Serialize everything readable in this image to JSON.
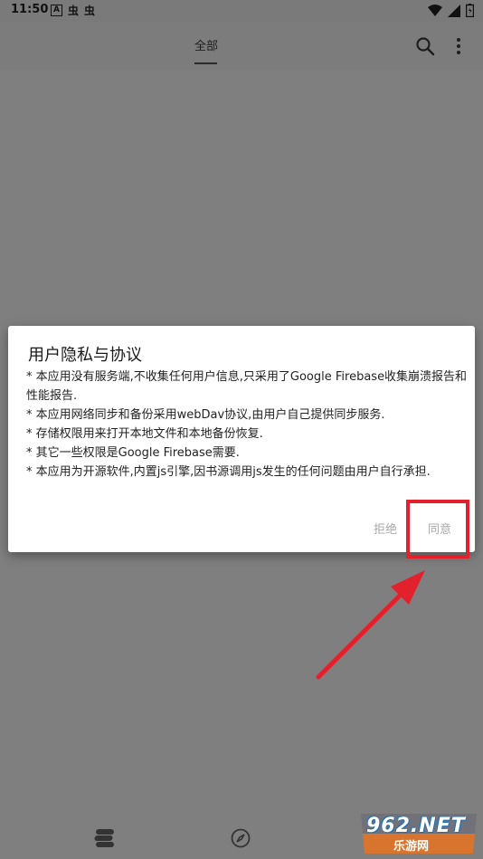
{
  "status_bar": {
    "time": "11:50",
    "left_icons": [
      "A",
      "虫",
      "虫"
    ]
  },
  "app_bar": {
    "tab_label": "全部"
  },
  "dialog": {
    "title": "用户隐私与协议",
    "lines": [
      "* 本应用没有服务端,不收集任何用户信息,只采用了Google Firebase收集崩溃报告和性能报告.",
      "* 本应用网络同步和备份采用webDav协议,由用户自己提供同步服务.",
      "* 存储权限用来打开本地文件和本地备份恢复.",
      "* 其它一些权限是Google Firebase需要.",
      "* 本应用为开源软件,内置js引擎,因书源调用js发生的任何问题由用户自行承担."
    ],
    "reject_label": "拒绝",
    "agree_label": "同意"
  },
  "watermark": {
    "main": "962.NET",
    "sub": "乐游网"
  },
  "colors": {
    "scrim": "#7f7f7f",
    "annotation_red": "#e3212d",
    "dialog_bg": "#ffffff",
    "button_text": "#a8a8a8"
  }
}
